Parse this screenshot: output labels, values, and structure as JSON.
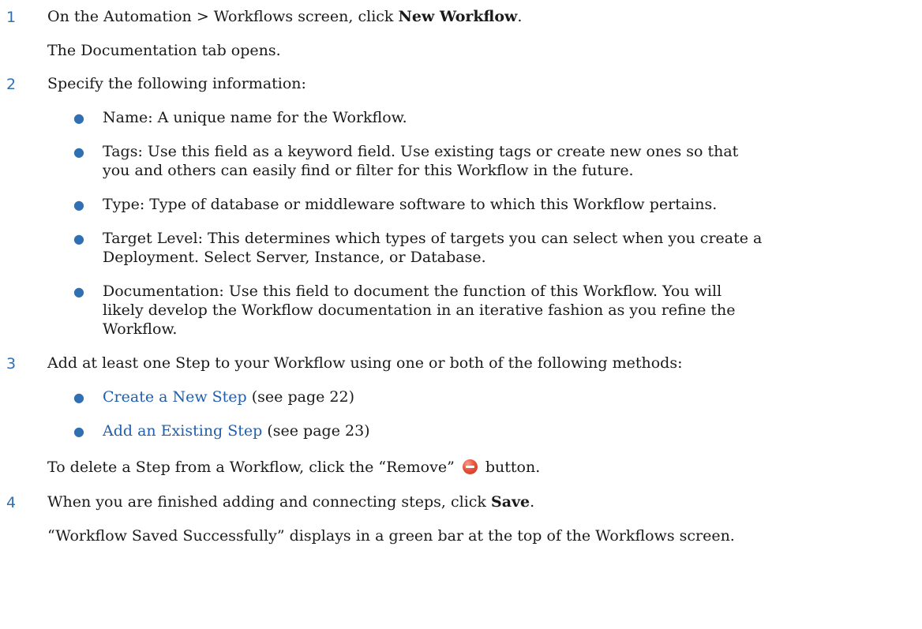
{
  "steps": [
    {
      "number": "1",
      "prefix": "On the Automation > Workflows screen, click ",
      "bold": "New Workflow",
      "suffix": ".",
      "note": "The Documentation tab opens."
    },
    {
      "number": "2",
      "text": "Specify the following information:",
      "bullets": [
        {
          "line1": "Name: A unique name for the Workflow."
        },
        {
          "line1": "Tags: Use this field as a keyword field. Use existing tags or create new ones so that",
          "line2": "you and others can easily find or filter for this Workflow in the future."
        },
        {
          "line1": "Type: Type of database or middleware software to which this Workflow pertains."
        },
        {
          "line1": "Target Level: This determines which types of targets you can select when you create a",
          "line2": "Deployment. Select Server, Instance, or Database."
        },
        {
          "line1": "Documentation: Use this field to document the function of this Workflow. You will",
          "line2": "likely develop the Workflow documentation in an iterative fashion as you refine the",
          "line3": "Workflow."
        }
      ]
    },
    {
      "number": "3",
      "text": "Add at least one Step to your Workflow using one or both of the following methods:",
      "links": [
        {
          "label": "Create a New Step",
          "ref": " (see page 22)"
        },
        {
          "label": "Add an Existing Step",
          "ref": " (see page 23)"
        }
      ],
      "remove_prefix": "To delete a Step from a Workflow, click the “Remove”",
      "remove_suffix": "button.",
      "remove_icon": "remove-icon"
    },
    {
      "number": "4",
      "prefix": "When you are finished adding and connecting steps, click ",
      "bold": "Save",
      "suffix": ".",
      "note": "“Workflow Saved Successfully” displays in a green bar at the top of the Workflows screen."
    }
  ],
  "colors": {
    "step_number": "#2f6fb2",
    "link": "#1f5fae",
    "bullet": "#2f6fb2",
    "remove_icon": "#e9523a"
  }
}
